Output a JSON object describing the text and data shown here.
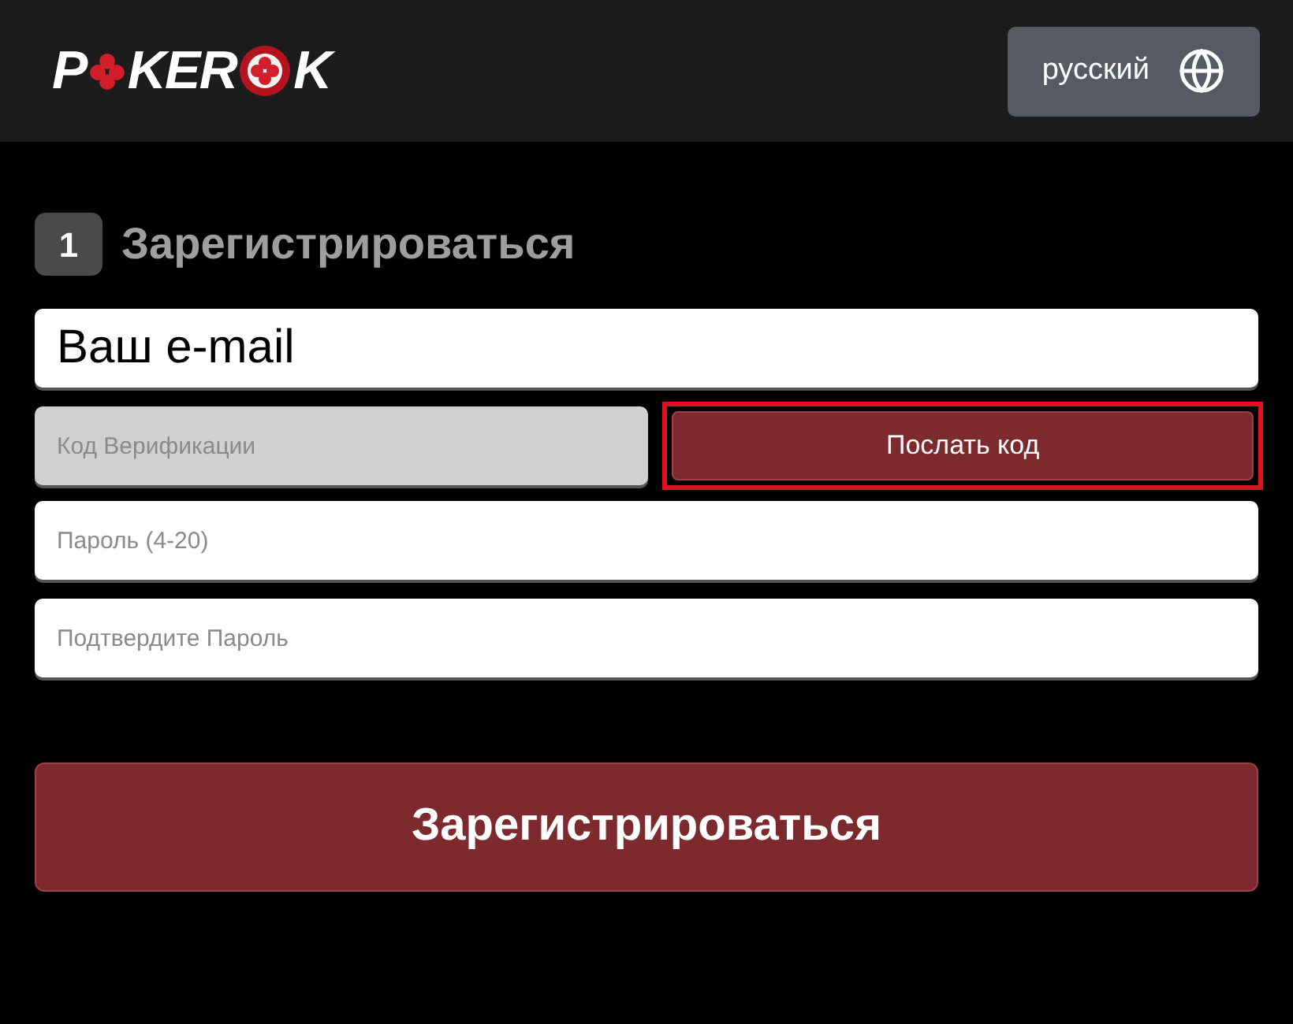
{
  "header": {
    "logo": {
      "start": "P",
      "middle": "KER",
      "end": "K"
    },
    "language_button": {
      "label": "русский"
    }
  },
  "form": {
    "step": "1",
    "title": "Зарегистрироваться",
    "email": {
      "value": "Ваш e-mail"
    },
    "code": {
      "placeholder": "Код Верификации",
      "disabled": true
    },
    "send_code_button": {
      "label": "Послать код",
      "highlighted": true
    },
    "password": {
      "placeholder": "Пароль (4-20)"
    },
    "confirm_password": {
      "placeholder": "Подтвердите Пароль"
    },
    "submit_button": {
      "label": "Зарегистрироваться"
    }
  }
}
